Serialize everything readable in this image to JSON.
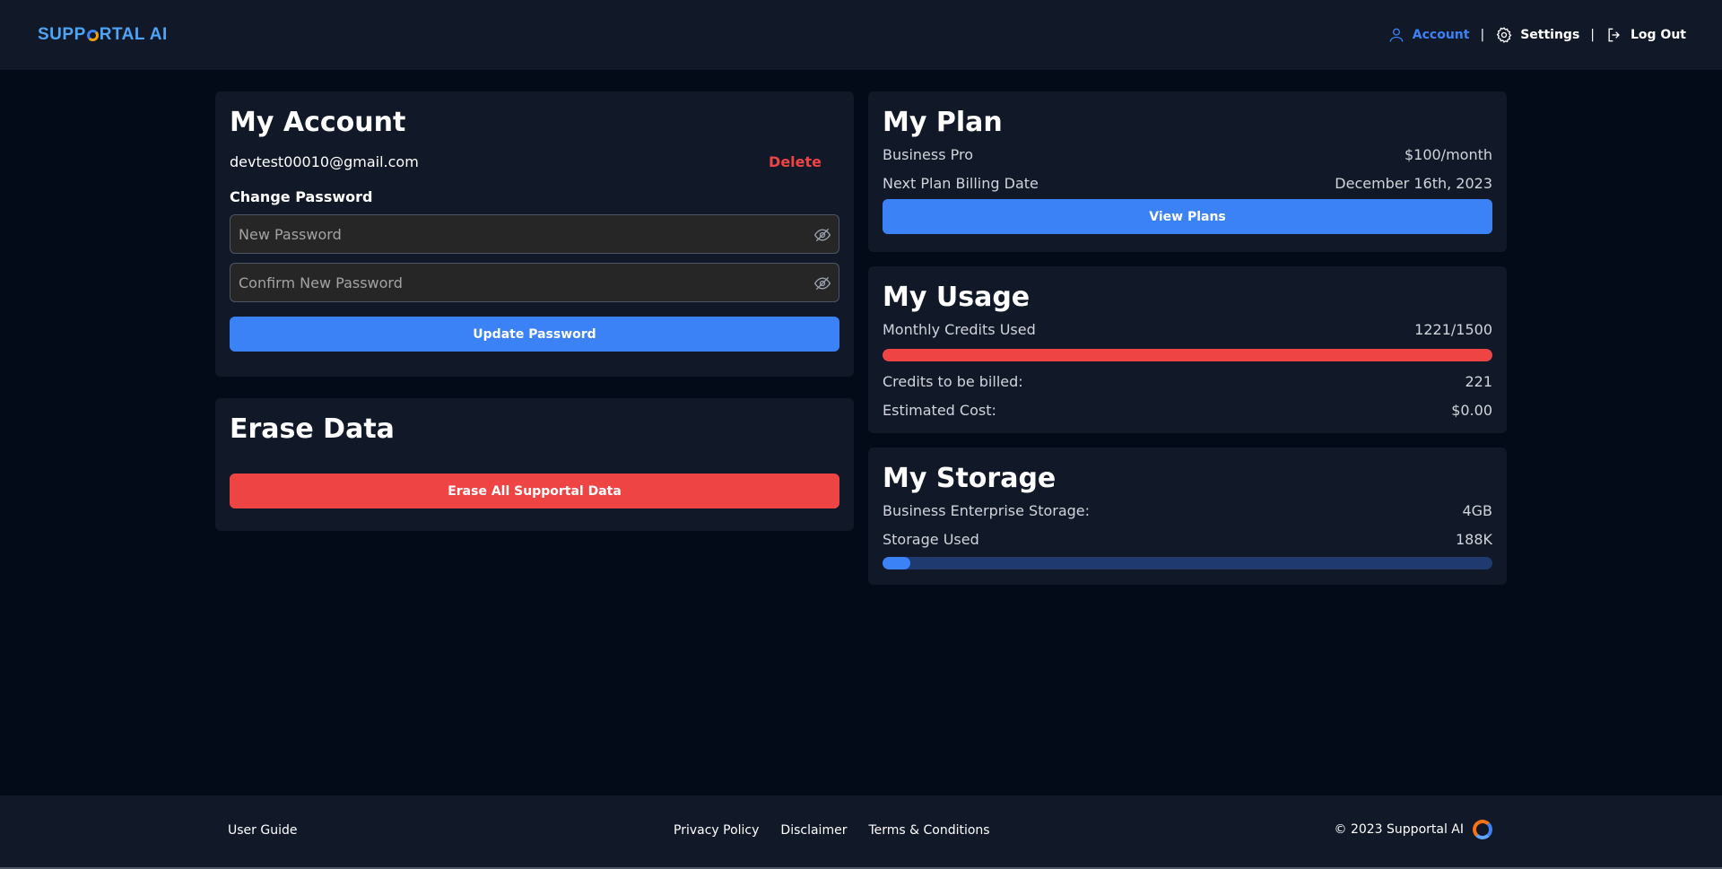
{
  "header": {
    "logo_left": "SUPP",
    "logo_right": "RTAL AI",
    "nav": {
      "account": "Account",
      "settings": "Settings",
      "logout": "Log Out",
      "separator": "|"
    }
  },
  "account": {
    "title": "My Account",
    "email": "devtest00010@gmail.com",
    "delete_label": "Delete",
    "change_password_label": "Change Password",
    "new_password_placeholder": "New Password",
    "confirm_password_placeholder": "Confirm New Password",
    "update_button": "Update Password"
  },
  "erase": {
    "title": "Erase Data",
    "button": "Erase All Supportal Data"
  },
  "plan": {
    "title": "My Plan",
    "name": "Business Pro",
    "price": "$100/month",
    "billing_label": "Next Plan Billing Date",
    "billing_date": "December 16th, 2023",
    "view_button": "View Plans"
  },
  "usage": {
    "title": "My Usage",
    "credits_label": "Monthly Credits Used",
    "credits_value": "1221/1500",
    "credits_fraction": 1.0,
    "billed_label": "Credits to be billed:",
    "billed_value": "221",
    "cost_label": "Estimated Cost:",
    "cost_value": "$0.00"
  },
  "storage": {
    "title": "My Storage",
    "plan_label": "Business Enterprise Storage:",
    "plan_value": "4GB",
    "used_label": "Storage Used",
    "used_value": "188K",
    "used_fraction": 0.045
  },
  "footer": {
    "user_guide": "User Guide",
    "links": [
      "Privacy Policy",
      "Disclaimer",
      "Terms & Conditions"
    ],
    "copyright": "© 2023 Supportal AI"
  },
  "colors": {
    "accent": "#3b82f6",
    "danger": "#ef4444",
    "card": "#111827",
    "background": "#030a18"
  }
}
